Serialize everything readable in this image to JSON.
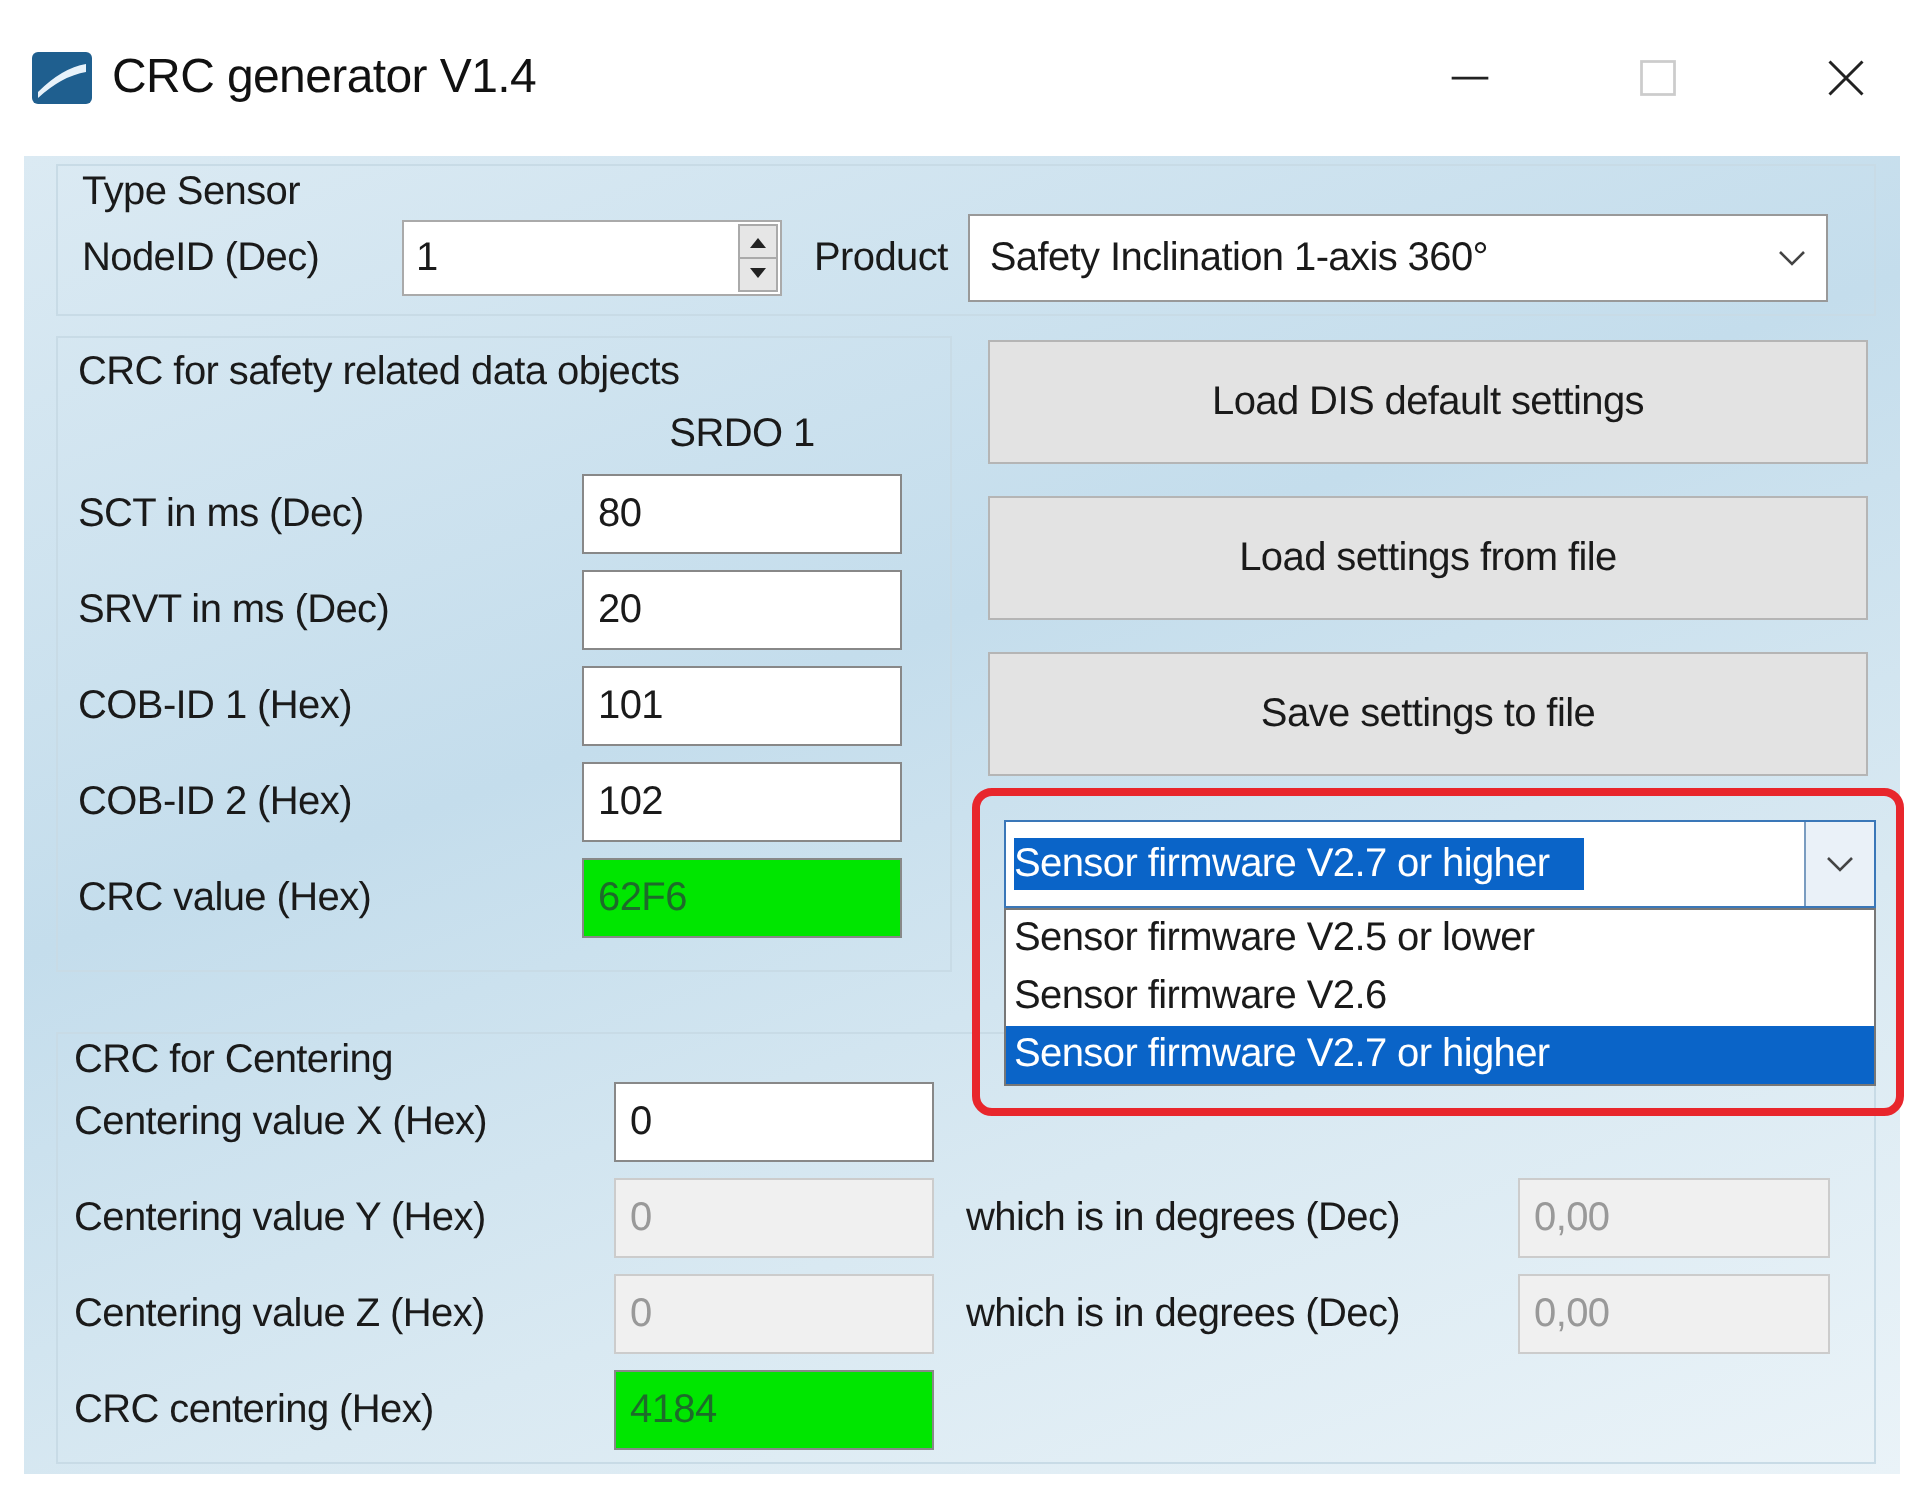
{
  "window": {
    "title": "CRC generator V1.4"
  },
  "type_sensor": {
    "title": "Type Sensor",
    "node_id": {
      "label": "NodeID (Dec)",
      "value": "1"
    },
    "product": {
      "label": "Product",
      "value": "Safety Inclination 1-axis 360°"
    }
  },
  "crc_safety": {
    "title": "CRC for safety related data objects",
    "column_header": "SRDO 1",
    "rows": [
      {
        "label": "SCT in ms (Dec)",
        "value": "80",
        "kind": "input"
      },
      {
        "label": "SRVT in ms (Dec)",
        "value": "20",
        "kind": "input"
      },
      {
        "label": "COB-ID 1 (Hex)",
        "value": "101",
        "kind": "input"
      },
      {
        "label": "COB-ID 2 (Hex)",
        "value": "102",
        "kind": "input"
      },
      {
        "label": "CRC value (Hex)",
        "value": "62F6",
        "kind": "result"
      }
    ]
  },
  "buttons": [
    "Load DIS default settings",
    "Load settings from file",
    "Save settings to file"
  ],
  "firmware_dropdown": {
    "value": "Sensor firmware V2.7 or higher",
    "highlighted": true,
    "options": [
      {
        "label": "Sensor firmware V2.5 or lower",
        "selected": false
      },
      {
        "label": "Sensor firmware V2.6",
        "selected": false
      },
      {
        "label": "Sensor firmware V2.7 or higher",
        "selected": true
      }
    ]
  },
  "centering": {
    "title": "CRC for Centering",
    "rows": [
      {
        "label": "Centering value X (Hex)",
        "value": "0",
        "disabled": false
      },
      {
        "label": "Centering value Y (Hex)",
        "value": "0",
        "disabled": true,
        "degrees_label": "which is in degrees (Dec)",
        "degrees_value": "0,00"
      },
      {
        "label": "Centering value Z (Hex)",
        "value": "0",
        "disabled": true,
        "degrees_label": "which is in degrees (Dec)",
        "degrees_value": "0,00"
      }
    ],
    "crc": {
      "label": "CRC centering (Hex)",
      "value": "4184"
    }
  }
}
